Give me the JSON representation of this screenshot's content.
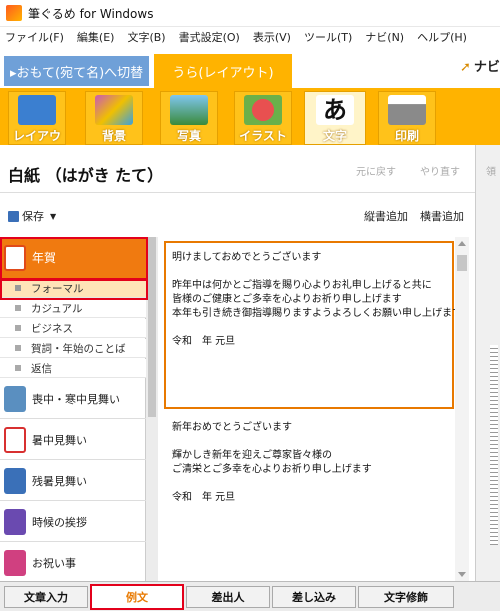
{
  "window": {
    "title": "筆ぐるめ for Windows"
  },
  "menu": [
    "ファイル(F)",
    "編集(E)",
    "文字(B)",
    "書式設定(O)",
    "表示(V)",
    "ツール(T)",
    "ナビ(N)",
    "ヘルプ(H)"
  ],
  "tabs": {
    "omote": "▸おもて(宛て名)へ切替",
    "ura": "うら(レイアウト)",
    "navi": "ナビ"
  },
  "toolbar": [
    {
      "label": "レイアウト",
      "color": "#3b7fd0"
    },
    {
      "label": "背景",
      "color": "#c85ab8"
    },
    {
      "label": "写真",
      "color": "#4aa0d8"
    },
    {
      "label": "イラスト",
      "color": "#e85050"
    },
    {
      "label": "文字",
      "color": "#222222"
    },
    {
      "label": "印刷",
      "color": "#8a8a8a"
    }
  ],
  "doc": {
    "title": "白紙 （はがき たて）",
    "undo": "元に戻す",
    "redo": "やり直す",
    "right_label": "領"
  },
  "save_row": {
    "save": "保存",
    "vertical_add": "縦書追加",
    "horizontal_add": "横書追加"
  },
  "categories": [
    {
      "label": "年賀",
      "color": "#e04a1a"
    },
    {
      "label": "喪中・寒中見舞い",
      "color": "#5a8fc0"
    },
    {
      "label": "暑中見舞い",
      "color": "#d83030"
    },
    {
      "label": "残暑見舞い",
      "color": "#3a70b8"
    },
    {
      "label": "時候の挨拶",
      "color": "#6a4ab0"
    },
    {
      "label": "お祝い事",
      "color": "#d04080"
    }
  ],
  "subcategories": [
    "フォーマル",
    "カジュアル",
    "ビジネス",
    "賀詞・年始のことば",
    "返信"
  ],
  "examples": [
    {
      "lines": [
        "明けましておめでとうございます",
        "",
        "昨年中は何かとご指導を賜り心よりお礼申し上げると共に",
        "皆様のご健康とご多幸を心よりお祈り申し上げます",
        "本年も引き続き御指導賜りますようよろしくお願い申し上げます",
        "",
        "令和　年 元旦"
      ]
    },
    {
      "lines": [
        "新年おめでとうございます",
        "",
        "輝かしき新年を迎えご尊家皆々様の",
        "ご清栄とご多幸を心よりお祈り申し上げます",
        "",
        "令和　年 元旦"
      ]
    }
  ],
  "bottom_tabs": [
    "文章入力",
    "例文",
    "差出人",
    "差し込み",
    "文字修飾"
  ],
  "colors": {
    "accent": "#ffb300",
    "selected_box": "#e3001b",
    "category_active": "#f07a10"
  }
}
